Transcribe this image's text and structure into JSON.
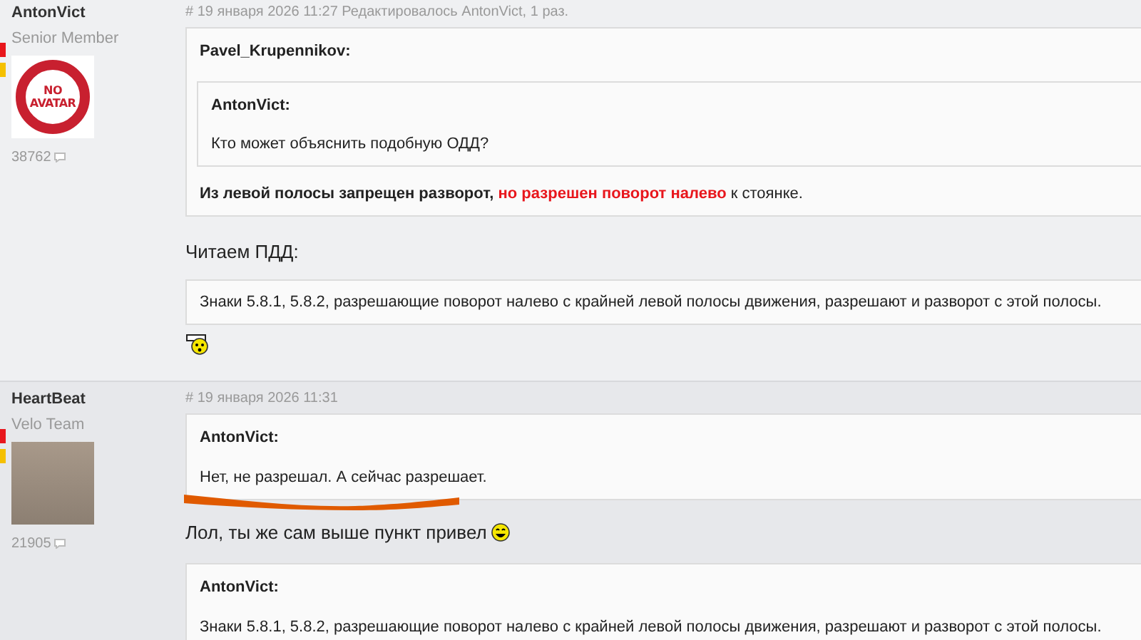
{
  "posts": [
    {
      "author": "AntonVict",
      "rank": "Senior Member",
      "avatar": {
        "kind": "none",
        "label": "NO AVATAR"
      },
      "count": "38762",
      "meta": {
        "anchor": "#",
        "date": "19 января 2026 11:27",
        "edited_prefix": "Редактировалось",
        "editor": "AntonVict",
        "edited_suffix": ", 1 раз."
      },
      "blocks": [
        {
          "kind": "quote",
          "author": "Pavel_Krupennikov:",
          "children": [
            {
              "kind": "quote",
              "author": "AntonVict:",
              "children": [
                {
                  "kind": "text",
                  "segments": [
                    {
                      "kind": "plain",
                      "text": "Кто может объяснить подобную ОДД?"
                    }
                  ]
                }
              ]
            },
            {
              "kind": "text",
              "segments": [
                {
                  "kind": "bold",
                  "text": "Из левой полосы запрещен разворот,"
                },
                {
                  "kind": "alert",
                  "text": "но разрешен поворот налево"
                },
                {
                  "kind": "plain",
                  "text": "к стоянке."
                }
              ]
            }
          ]
        },
        {
          "kind": "para",
          "text": "Читаем ПДД:"
        },
        {
          "kind": "quote",
          "children": [
            {
              "kind": "text",
              "segments": [
                {
                  "kind": "plain",
                  "text": "Знаки 5.8.1, 5.8.2, разрешающие поворот налево с крайней левой полосы движения, разрешают и разворот с этой полосы."
                }
              ]
            }
          ]
        },
        {
          "kind": "smiley"
        }
      ]
    },
    {
      "author": "HeartBeat",
      "rank": "Velo Team",
      "avatar": {
        "kind": "photo"
      },
      "count": "21905",
      "meta": {
        "anchor": "#",
        "date": "19 января 2026 11:31"
      },
      "blocks": [
        {
          "kind": "quote",
          "author": "AntonVict:",
          "children": [
            {
              "kind": "text",
              "segments": [
                {
                  "kind": "plain",
                  "text": "Нет, не разрешал. А сейчас разрешает."
                }
              ]
            }
          ]
        },
        {
          "kind": "scribble"
        },
        {
          "kind": "para",
          "text": "Лол, ты же сам выше пункт привел",
          "emoticon": true
        },
        {
          "kind": "quote",
          "author": "AntonVict:",
          "children": [
            {
              "kind": "text",
              "segments": [
                {
                  "kind": "plain",
                  "text": "Знаки 5.8.1, 5.8.2, разрешающие поворот налево с крайней левой полосы движения, разрешают и разворот с этой полосы."
                }
              ]
            }
          ]
        }
      ]
    }
  ]
}
